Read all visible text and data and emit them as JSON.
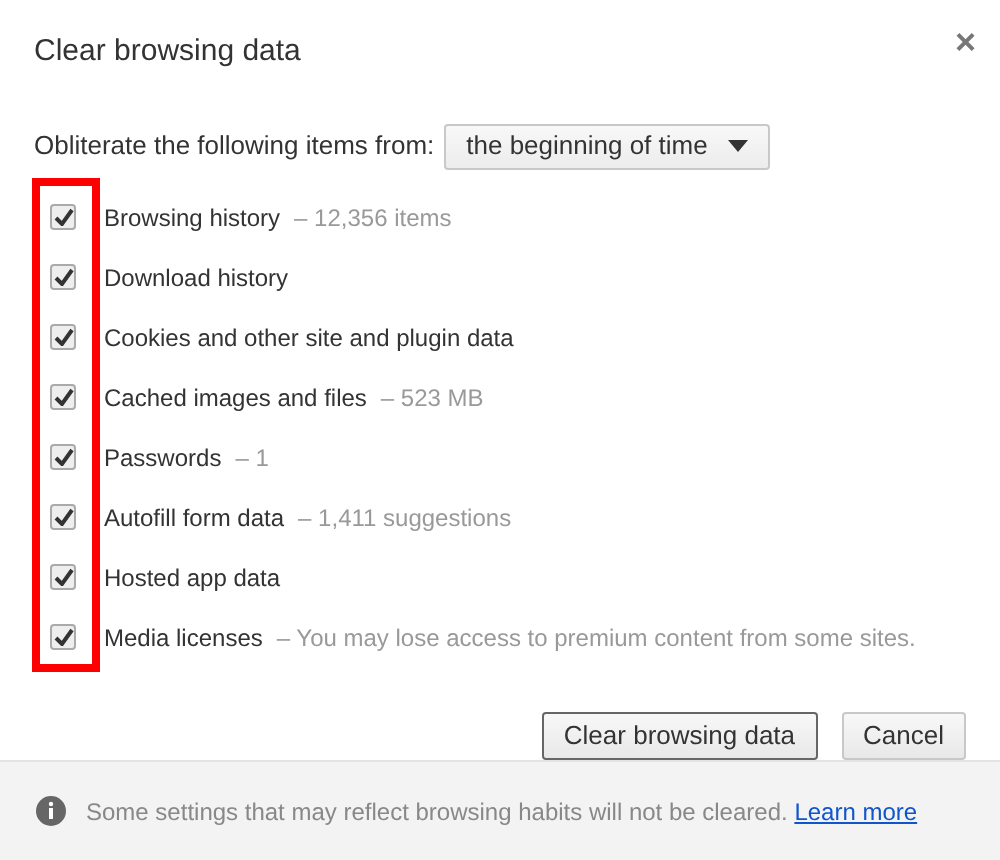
{
  "dialog": {
    "title": "Clear browsing data",
    "close": "×"
  },
  "range": {
    "label": "Obliterate the following items from:",
    "value": "the beginning of time"
  },
  "items": [
    {
      "label": "Browsing history",
      "detail": "– 12,356 items",
      "checked": true
    },
    {
      "label": "Download history",
      "checked": true
    },
    {
      "label": "Cookies and other site and plugin data",
      "checked": true
    },
    {
      "label": "Cached images and files",
      "detail": "– 523 MB",
      "checked": true
    },
    {
      "label": "Passwords",
      "detail": "– 1",
      "checked": true
    },
    {
      "label": "Autofill form data",
      "detail": "– 1,411 suggestions",
      "checked": true
    },
    {
      "label": "Hosted app data",
      "checked": true
    },
    {
      "label": "Media licenses",
      "detail": "– You may lose access to premium content from some sites.",
      "checked": true
    }
  ],
  "highlight_frame": true,
  "buttons": [
    {
      "label": "Clear browsing data",
      "kind": "primary"
    },
    {
      "label": "Cancel",
      "kind": "secondary"
    }
  ],
  "footer": {
    "text": "Some settings that may reflect browsing habits will not be cleared.",
    "link": "Learn more"
  }
}
